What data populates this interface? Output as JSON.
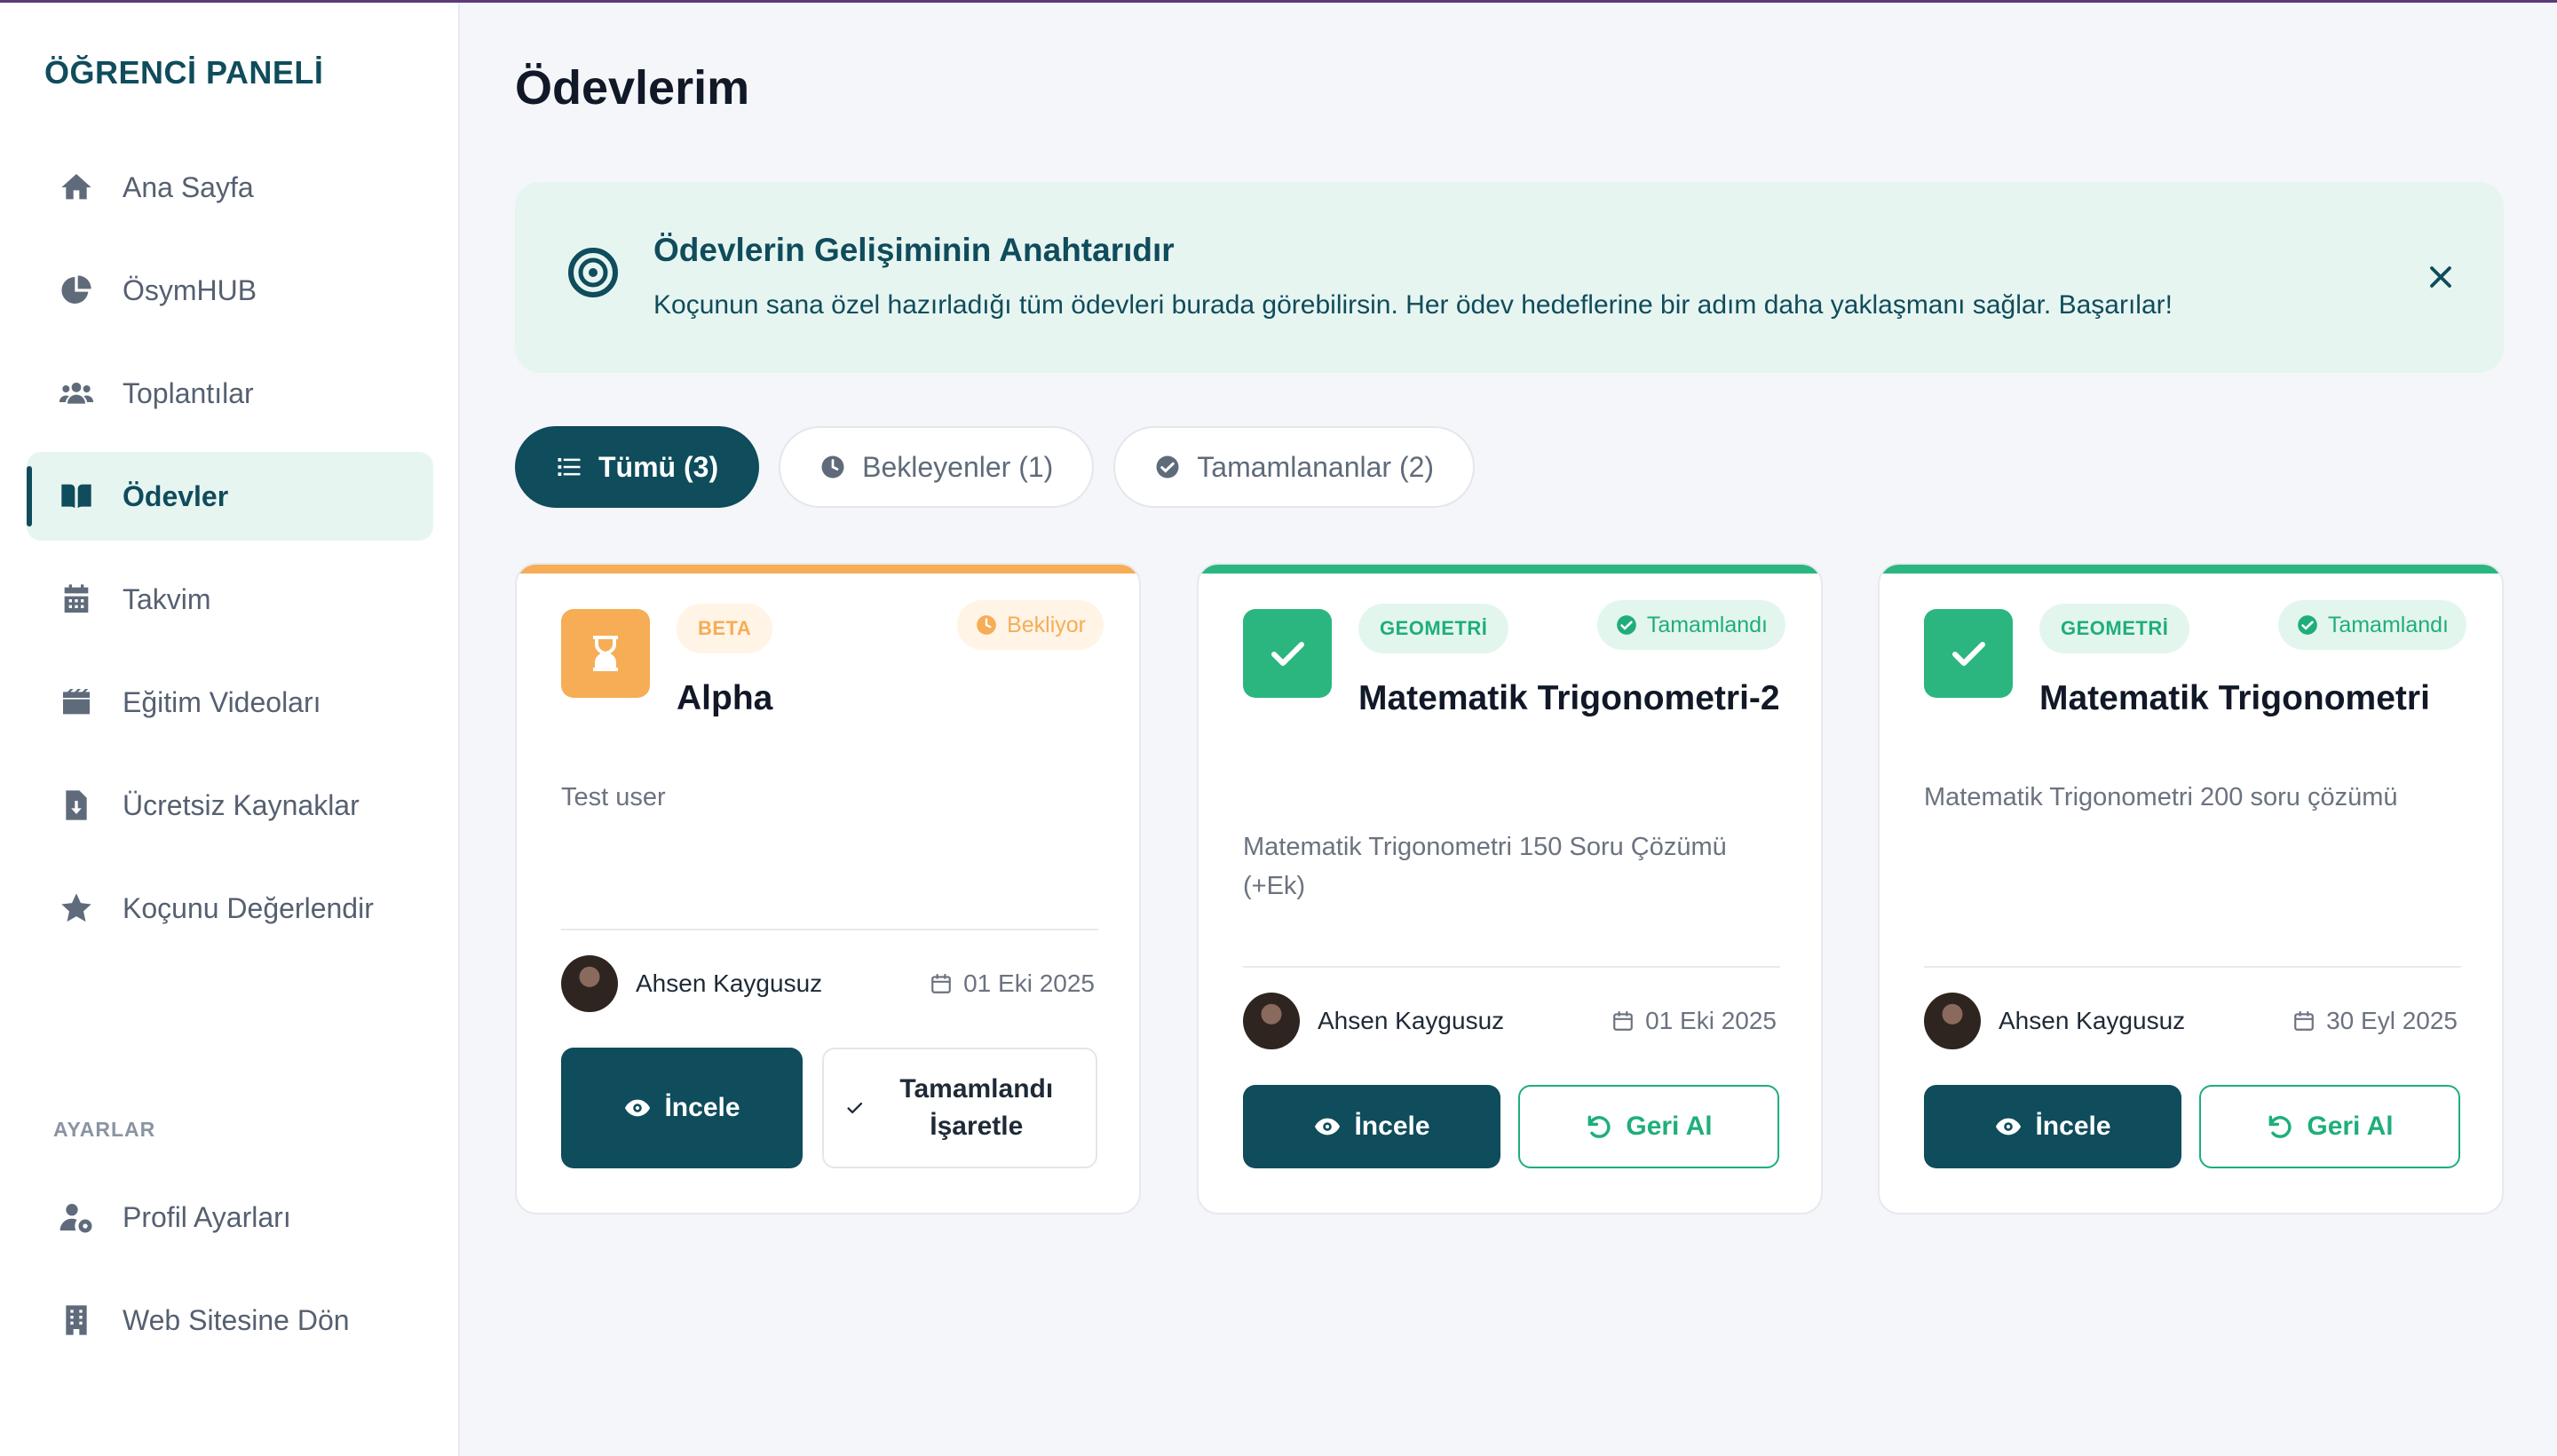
{
  "sidebar": {
    "brand": "ÖĞRENCİ PANELİ",
    "items": [
      {
        "label": "Ana Sayfa",
        "icon": "home-icon",
        "active": false
      },
      {
        "label": "ÖsymHUB",
        "icon": "pie-chart-icon",
        "active": false
      },
      {
        "label": "Toplantılar",
        "icon": "users-icon",
        "active": false
      },
      {
        "label": "Ödevler",
        "icon": "book-open-icon",
        "active": true
      },
      {
        "label": "Takvim",
        "icon": "calendar-icon",
        "active": false
      },
      {
        "label": "Eğitim Videoları",
        "icon": "video-icon",
        "active": false
      },
      {
        "label": "Ücretsiz Kaynaklar",
        "icon": "file-download-icon",
        "active": false
      },
      {
        "label": "Koçunu Değerlendir",
        "icon": "star-icon",
        "active": false
      }
    ],
    "settings_label": "AYARLAR",
    "settings_items": [
      {
        "label": "Profil Ayarları",
        "icon": "user-gear-icon"
      },
      {
        "label": "Web Sitesine Dön",
        "icon": "building-icon"
      }
    ]
  },
  "main": {
    "title": "Ödevlerim",
    "banner": {
      "title": "Ödevlerin Gelişiminin Anahtarıdır",
      "text": "Koçunun sana özel hazırladığı tüm ödevleri burada görebilirsin. Her ödev hedeflerine bir adım daha yaklaşmanı sağlar. Başarılar!"
    },
    "tabs": [
      {
        "label": "Tümü (3)",
        "icon": "list-icon",
        "active": true
      },
      {
        "label": "Bekleyenler (1)",
        "icon": "clock-icon",
        "active": false
      },
      {
        "label": "Tamamlananlar (2)",
        "icon": "check-circle-icon",
        "active": false
      }
    ],
    "cards": [
      {
        "subject": "BETA",
        "status": "Bekliyor",
        "title": "Alpha",
        "description": "Test user",
        "person": "Ahsen Kaygusuz",
        "date": "01 Eki 2025",
        "primary_button": "İncele",
        "secondary_button": "Tamamlandı İşaretle"
      },
      {
        "subject": "GEOMETRİ",
        "status": "Tamamlandı",
        "title": "Matematik Trigonometri-2",
        "description": "Matematik Trigonometri 150 Soru Çözümü (+Ek)",
        "person": "Ahsen Kaygusuz",
        "date": "01 Eki 2025",
        "primary_button": "İncele",
        "secondary_button": "Geri Al"
      },
      {
        "subject": "GEOMETRİ",
        "status": "Tamamlandı",
        "title": "Matematik Trigonometri",
        "description": "Matematik Trigonometri 200 soru çözümü",
        "person": "Ahsen Kaygusuz",
        "date": "30 Eyl 2025",
        "primary_button": "İncele",
        "secondary_button": "Geri Al"
      }
    ]
  },
  "colors": {
    "primary": "#0f4c5c",
    "success": "#1fae7a",
    "warning": "#f6ad55",
    "banner_bg": "#e7f5f1"
  }
}
